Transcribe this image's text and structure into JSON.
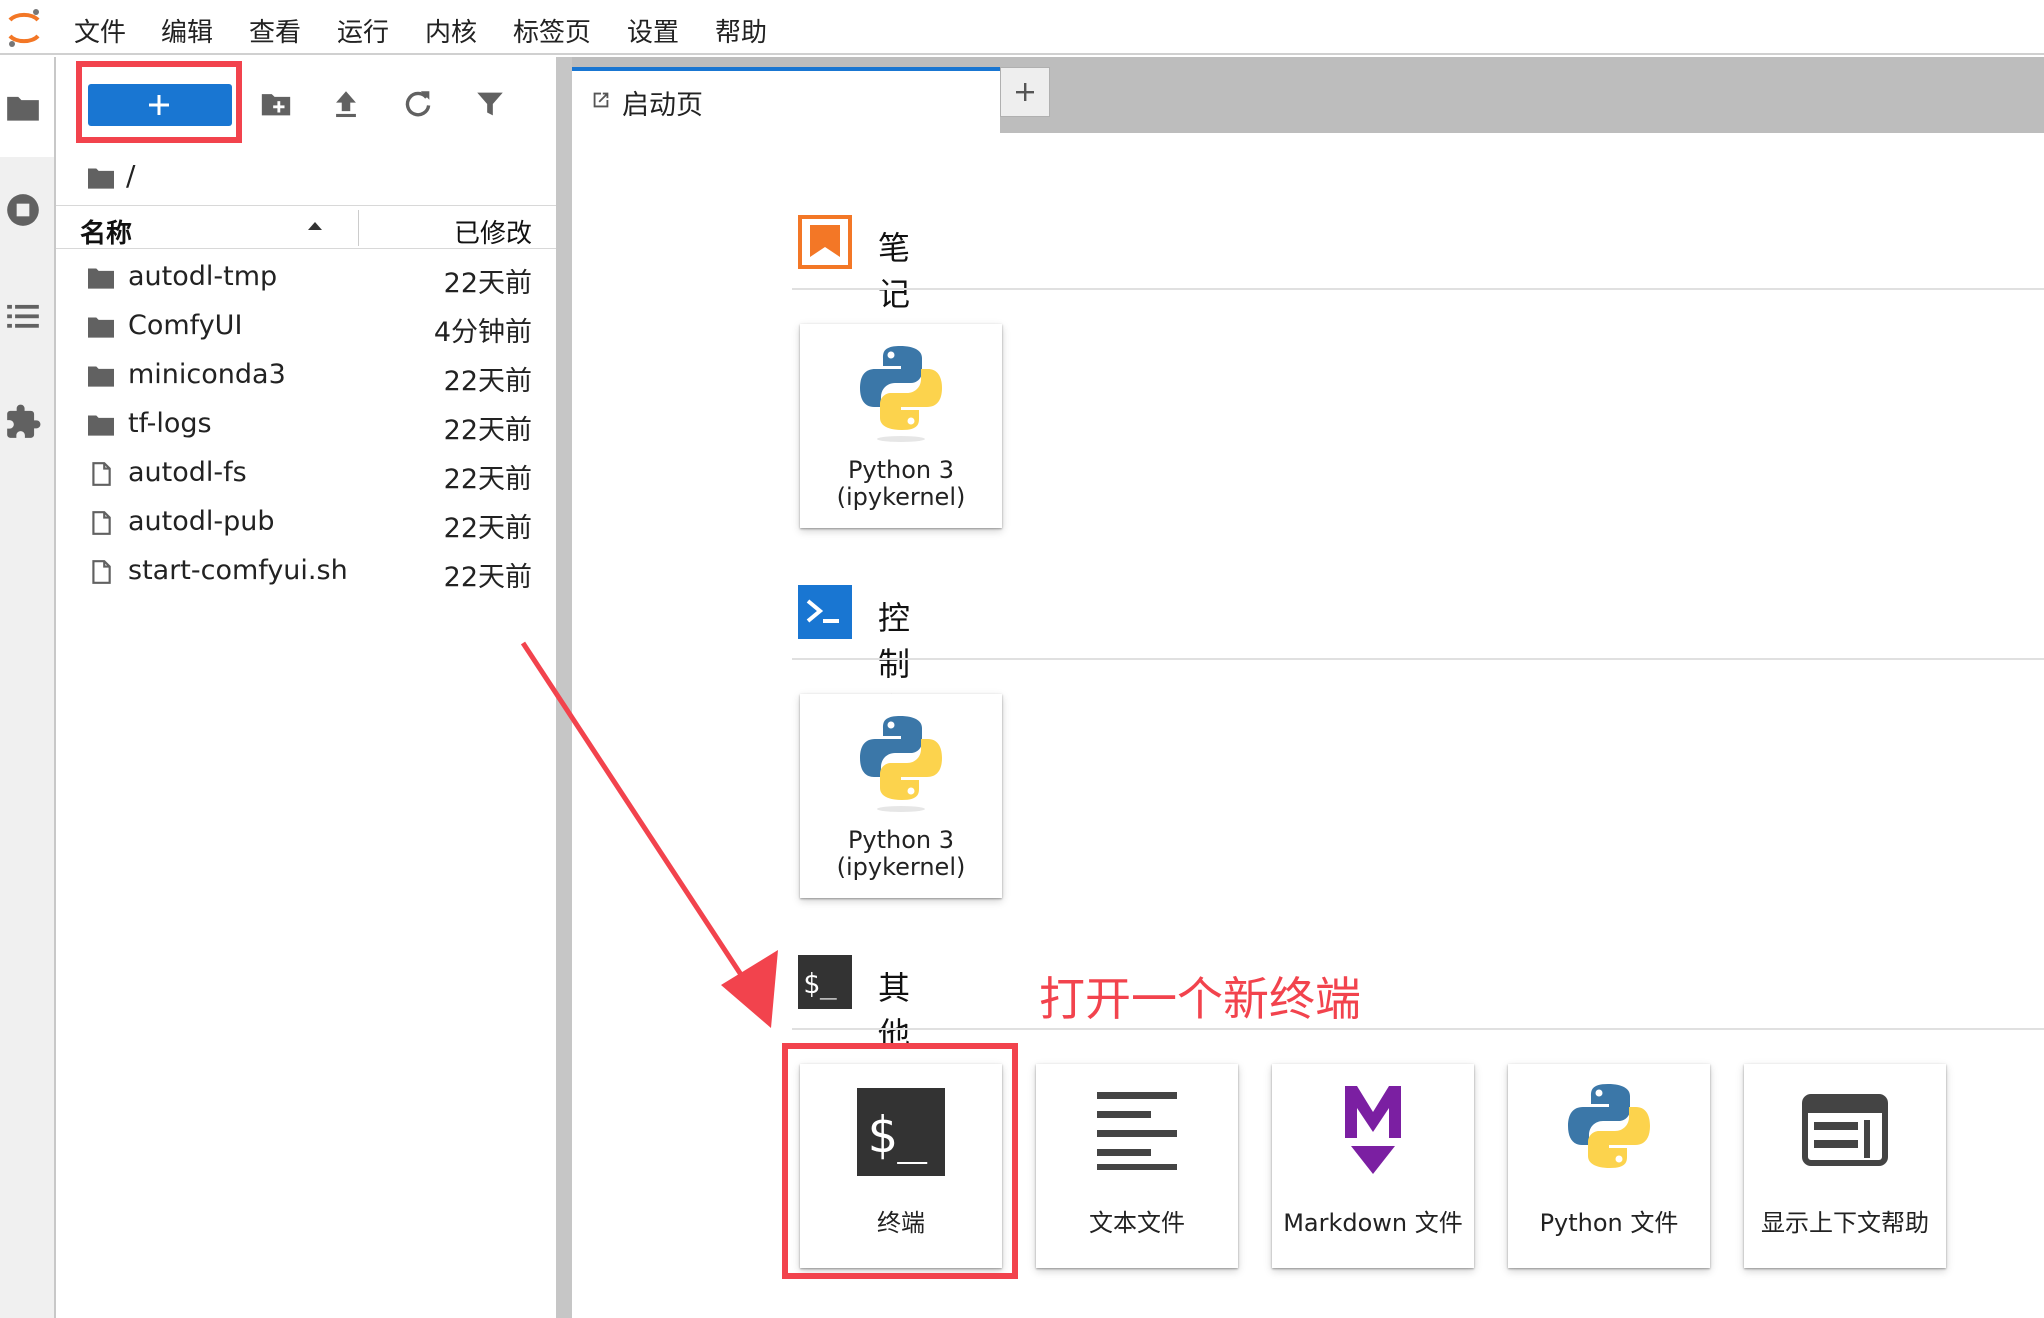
{
  "menu": {
    "items": [
      "文件",
      "编辑",
      "查看",
      "运行",
      "内核",
      "标签页",
      "设置",
      "帮助"
    ]
  },
  "filebrowser": {
    "breadcrumb": "/",
    "columns": {
      "name": "名称",
      "modified": "已修改"
    },
    "rows": [
      {
        "name": "autodl-tmp",
        "modified": "22天前",
        "type": "folder"
      },
      {
        "name": "ComfyUI",
        "modified": "4分钟前",
        "type": "folder"
      },
      {
        "name": "miniconda3",
        "modified": "22天前",
        "type": "folder"
      },
      {
        "name": "tf-logs",
        "modified": "22天前",
        "type": "folder"
      },
      {
        "name": "autodl-fs",
        "modified": "22天前",
        "type": "file"
      },
      {
        "name": "autodl-pub",
        "modified": "22天前",
        "type": "file"
      },
      {
        "name": "start-comfyui.sh",
        "modified": "22天前",
        "type": "file"
      }
    ]
  },
  "tabs": {
    "launcher_label": "启动页"
  },
  "launcher": {
    "notebook": {
      "title": "笔记本",
      "kernel_line1": "Python 3",
      "kernel_line2": "(ipykernel)"
    },
    "console": {
      "title": "控制台",
      "kernel_line1": "Python 3",
      "kernel_line2": "(ipykernel)"
    },
    "other": {
      "title": "其他",
      "items": [
        "终端",
        "文本文件",
        "Markdown 文件",
        "Python 文件",
        "显示上下文帮助"
      ]
    }
  },
  "annotation": {
    "text": "打开一个新终端"
  },
  "colors": {
    "accent": "#1976d2",
    "highlight": "#f2434d",
    "notebook_icon": "#f37726",
    "markdown_icon": "#7b1fa2"
  }
}
